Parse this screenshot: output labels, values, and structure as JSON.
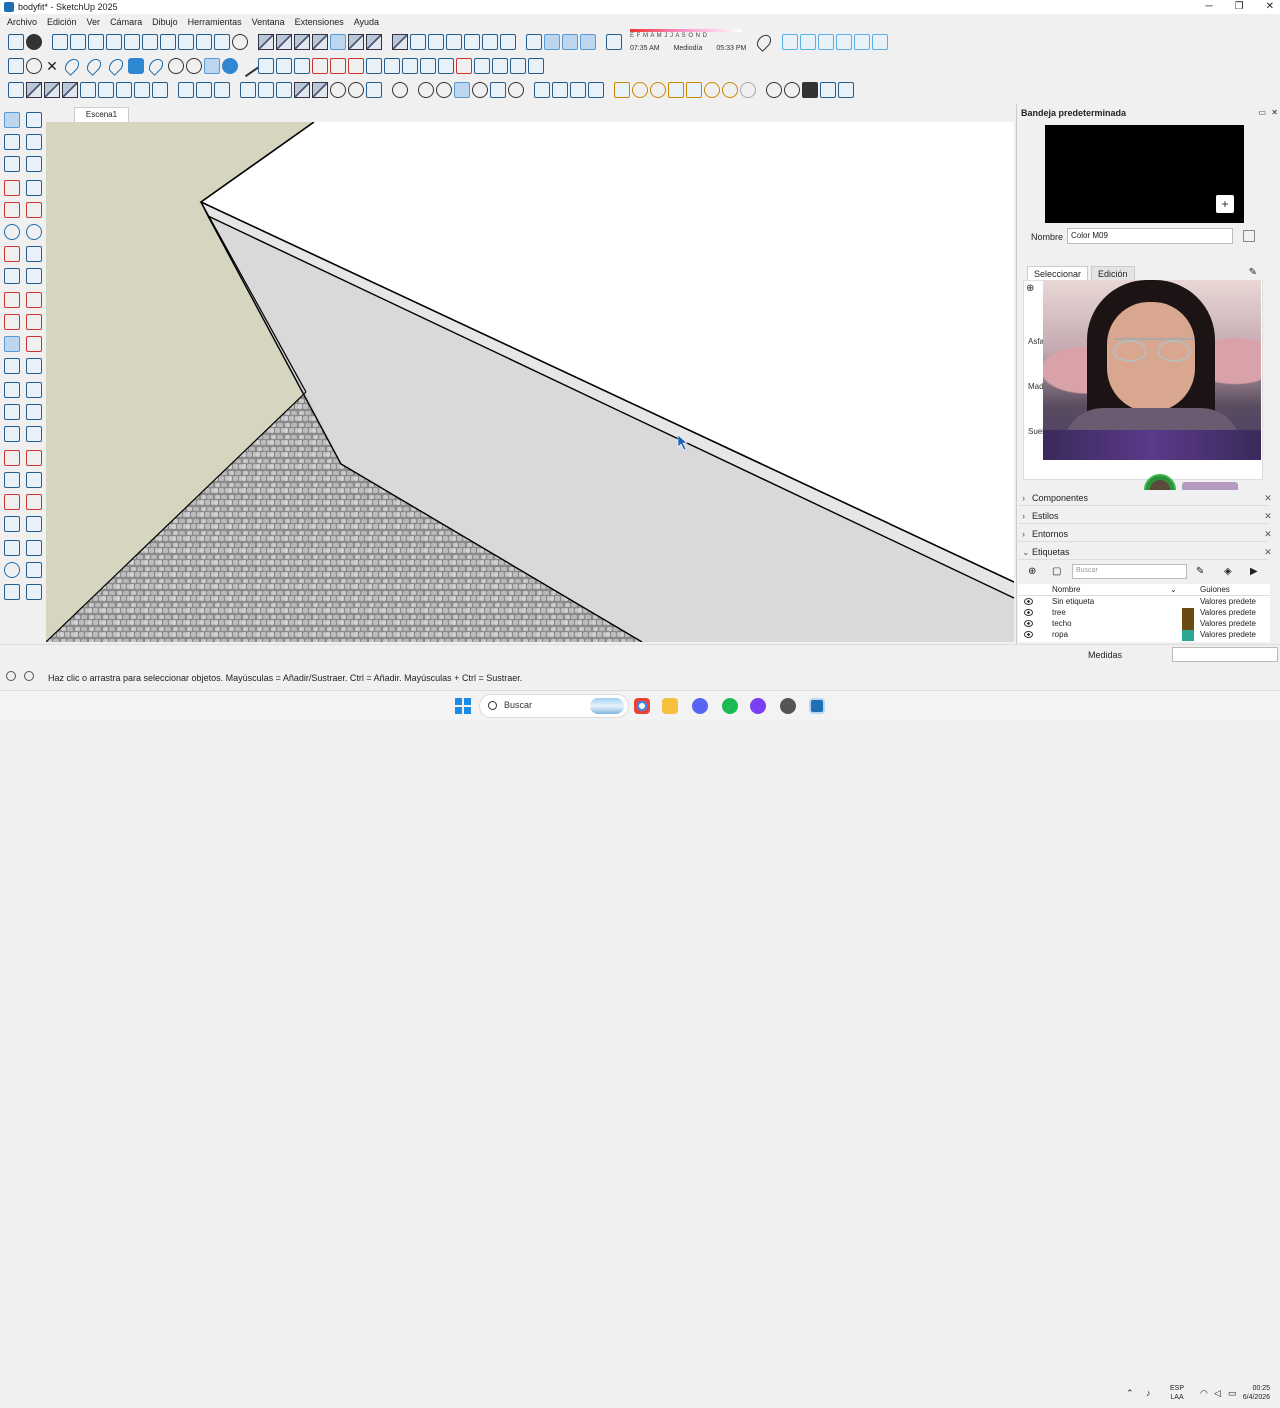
{
  "window": {
    "title": "bodyfit* - SketchUp 2025",
    "minimize": "─",
    "maximize": "❐",
    "close": "✕"
  },
  "menu": [
    "Archivo",
    "Edición",
    "Ver",
    "Cámara",
    "Dibujo",
    "Herramientas",
    "Ventana",
    "Extensiones",
    "Ayuda"
  ],
  "shadows": {
    "months": "E F M A M J J A S O N D",
    "time_start": "07:35 AM",
    "midday": "Mediodía",
    "time_end": "05:33 PM"
  },
  "scene_tab": "Escena1",
  "tray": {
    "title": "Bandeja predeterminada",
    "material_preview_color": "#000000",
    "name_label": "Nombre",
    "name_value": "Color M09",
    "tab_select": "Seleccionar",
    "tab_edit": "Edición",
    "material_items": [
      "Asfa",
      "Mad",
      "Suel"
    ],
    "panels": [
      "Componentes",
      "Estilos",
      "Entornos",
      "Etiquetas"
    ],
    "tag_search_placeholder": "Buscar",
    "tag_headers": {
      "name": "Nombre",
      "dashes": "Guiones"
    },
    "tags": [
      {
        "name": "Sin etiqueta",
        "dashes": "Valores predete",
        "color": ""
      },
      {
        "name": "tree",
        "dashes": "Valores predete",
        "color": "#6b4a12"
      },
      {
        "name": "techo",
        "dashes": "Valores predete",
        "color": "#6b4a12"
      },
      {
        "name": "ropa",
        "dashes": "Valores predete",
        "color": "#2aa893"
      }
    ]
  },
  "status": {
    "hint": "Haz clic o arrastra para seleccionar objetos. Mayúsculas = Añadir/Sustraer. Ctrl = Añadir. Mayúsculas + Ctrl = Sustraer.",
    "measure_label": "Medidas",
    "measure_value": ""
  },
  "taskbar": {
    "search": "Buscar",
    "lang_top": "ESP",
    "lang_bottom": "LAA",
    "time": "00:25",
    "date": "6/4/2026"
  },
  "colors": {
    "ground": "#d6d6c0",
    "wall_face": "#d8d8d8",
    "wall_top": "#ffffff",
    "accent": "#1a8ce8"
  }
}
